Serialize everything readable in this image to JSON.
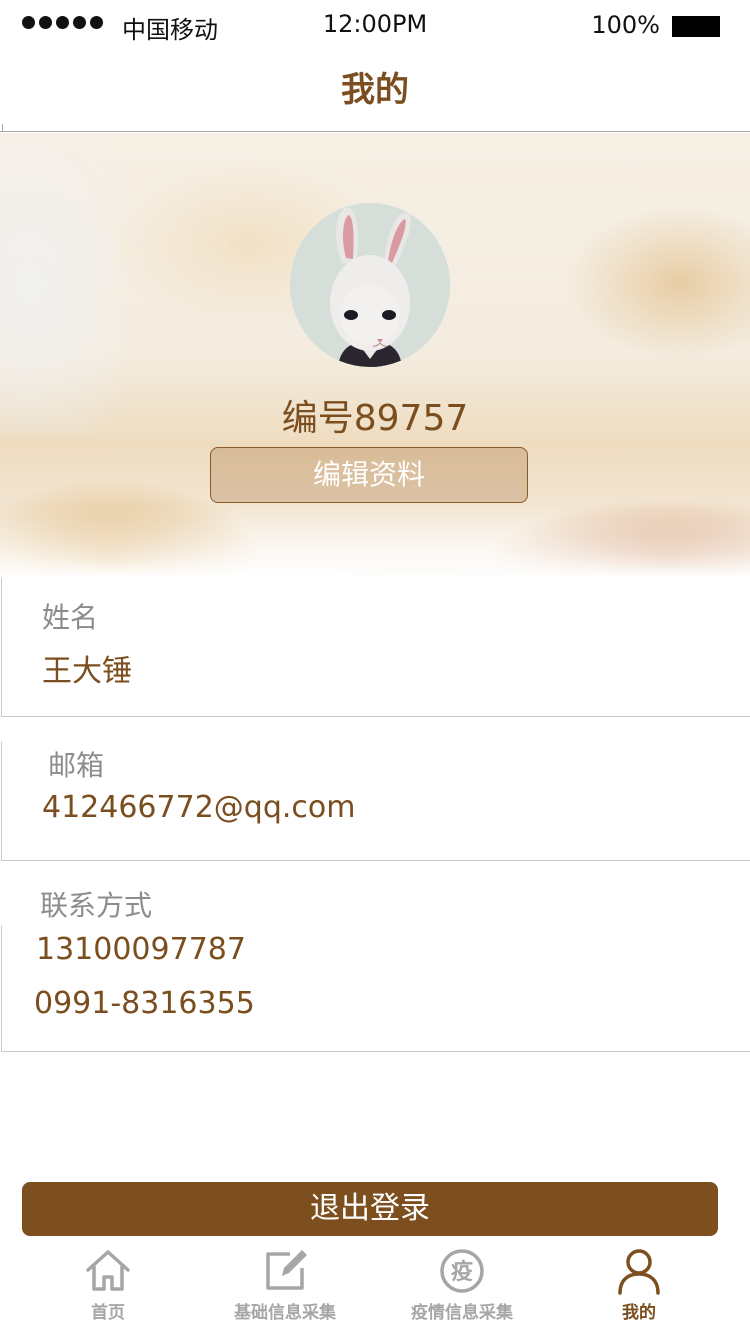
{
  "status_bar": {
    "carrier": "中国移动",
    "time": "12:00PM",
    "battery": "100%"
  },
  "nav": {
    "title": "我的"
  },
  "profile": {
    "id_text": "编号89757",
    "edit_label": "编辑资料"
  },
  "fields": {
    "name": {
      "label": "姓名",
      "value": "王大锤"
    },
    "email": {
      "label": "邮箱",
      "value": "412466772@qq.com"
    },
    "contact": {
      "label": "联系方式",
      "mobile": "13100097787",
      "phone": "0991-8316355"
    }
  },
  "logout_label": "退出登录",
  "tabs": [
    {
      "label": "首页",
      "icon": "home-icon",
      "active": false
    },
    {
      "label": "基础信息采集",
      "icon": "edit-icon",
      "active": false
    },
    {
      "label": "疫情信息采集",
      "icon": "epidemic-icon",
      "glyph": "疫",
      "active": false
    },
    {
      "label": "我的",
      "icon": "user-icon",
      "active": true
    }
  ],
  "colors": {
    "brand": "#7d4f1e",
    "label_gray": "#8c8c8c",
    "inactive_tab": "#a6a6a6"
  }
}
